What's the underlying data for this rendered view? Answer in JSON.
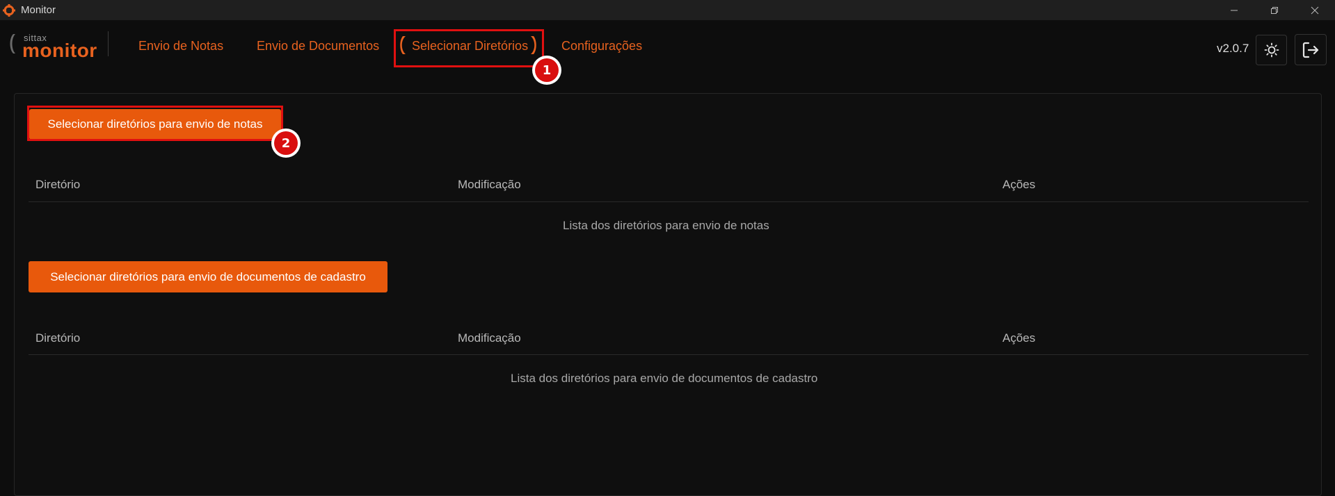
{
  "window": {
    "title": "Monitor",
    "controls": [
      "minimize",
      "restore",
      "close"
    ]
  },
  "header": {
    "logo": {
      "sub": "sittax",
      "main": "monitor"
    },
    "nav": [
      {
        "label": "Envio de Notas"
      },
      {
        "label": "Envio de Documentos"
      },
      {
        "label": "Selecionar Diretórios",
        "active": true
      },
      {
        "label": "Configurações"
      }
    ],
    "version": "v2.0.7"
  },
  "annotations": [
    {
      "number": "1"
    },
    {
      "number": "2"
    }
  ],
  "sections": {
    "notas": {
      "button_label": "Selecionar diretórios para envio de notas",
      "columns": [
        "Diretório",
        "Modificação",
        "Ações"
      ],
      "empty_message": "Lista dos diretórios para envio de notas"
    },
    "documentos": {
      "button_label": "Selecionar diretórios para envio de documentos de cadastro",
      "columns": [
        "Diretório",
        "Modificação",
        "Ações"
      ],
      "empty_message": "Lista dos diretórios para envio de documentos de cadastro"
    }
  },
  "colors": {
    "accent": "#e8590c",
    "nav_text": "#e8621f",
    "annotation": "#d90f0f",
    "background": "#0d0d0d"
  }
}
